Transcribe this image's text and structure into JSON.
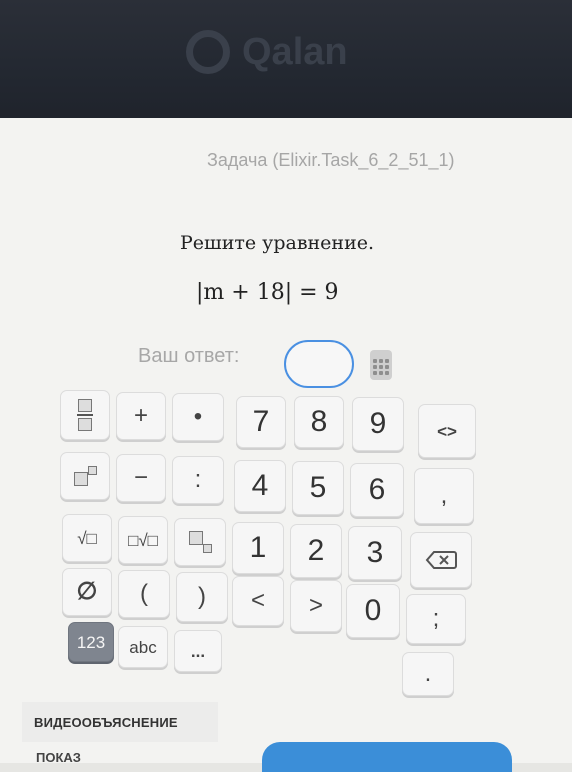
{
  "header": {
    "logo_text": "Qalan"
  },
  "task": {
    "id_text": "Задача (Elixir.Task_6_2_51_1)",
    "prompt": "Решите уравнение.",
    "equation": "|m + 18| = 9"
  },
  "answer": {
    "label": "Ваш ответ:",
    "value": ""
  },
  "keypad": {
    "row1": [
      "fraction",
      "+",
      "•",
      "7",
      "8",
      "9",
      "<>"
    ],
    "row2": [
      "power",
      "−",
      ":",
      "4",
      "5",
      "6",
      ","
    ],
    "row3": [
      "√□",
      "□√□",
      "subscript",
      "1",
      "2",
      "3",
      "backspace"
    ],
    "row4": [
      "∅",
      "(",
      ")",
      "<",
      ">",
      "0",
      ";"
    ],
    "row5": [
      "123",
      "abc",
      "...",
      "."
    ]
  },
  "actions": {
    "video": "ВИДЕООБЪЯСНЕНИЕ",
    "show": "ПОКАЗ",
    "primary_color": "#3b8ed8"
  }
}
